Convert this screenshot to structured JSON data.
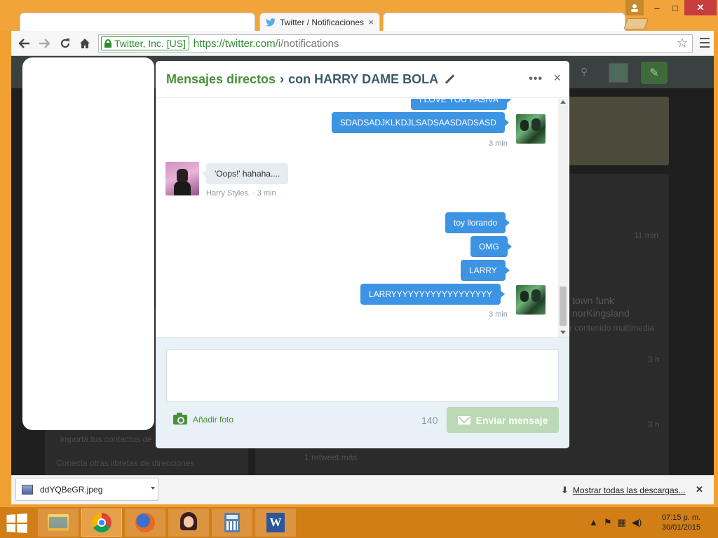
{
  "browser": {
    "tab_title": "Twitter / Notificaciones",
    "tab_close": "×",
    "window_controls": {
      "minimize": "–",
      "maximize": "□",
      "close": "✕"
    },
    "ev_owner": "Twitter, Inc. [US]",
    "url_scheme_host": "https://twitter.com",
    "url_path": "/i/notifications",
    "icons": {
      "back": "arrow-left",
      "forward": "arrow-right",
      "reload": "reload",
      "home": "home",
      "star": "star",
      "menu": "hamburger"
    }
  },
  "background_page": {
    "left_sub": "importa tus contactos de",
    "left_link": "Conecta otras libretas de direcciones",
    "right_items": [
      "11 min",
      "town funk",
      "norKingsland",
      "r contenido multimedia",
      "3 h",
      "3 h",
      "1 retweet más"
    ]
  },
  "dm": {
    "title_main": "Mensajes directos",
    "separator": "›",
    "title_with": "con HARRY DAME BOLA",
    "more_label": "•••",
    "close_label": "×",
    "messages": {
      "m0": "I LOVE YOU PASIVA",
      "m1": "SDADSADJKLKDJLSADSAASDADSASD",
      "m1_time": "3 min",
      "incoming": "'Oops!' hahaha....",
      "incoming_meta": "Harry Styles. · 3 min",
      "m2": "toy llorando",
      "m3": "OMG",
      "m4": "LARRY",
      "m5": "LARRYYYYYYYYYYYYYYYYYY",
      "m5_time": "3 min"
    },
    "add_photo": "Añadir foto",
    "char_count": "140",
    "send_label": "Enviar mensaje",
    "send_button_color": "#bad9b4",
    "brand_green": "#4a8f3a",
    "outgoing_bubble_color": "#3d94e3"
  },
  "downloads": {
    "file_name": "ddYQBeGR.jpeg",
    "show_all": "Mostrar todas las descargas...",
    "close_label": "✕"
  },
  "taskbar": {
    "apps": [
      "file-explorer",
      "chrome",
      "firefox",
      "girl-avatar-app",
      "calculator",
      "word"
    ],
    "word_letter": "W",
    "time": "07:15 p. m.",
    "date": "30/01/2015",
    "tray_icons": [
      "chevron-up",
      "flag",
      "network",
      "volume"
    ]
  }
}
